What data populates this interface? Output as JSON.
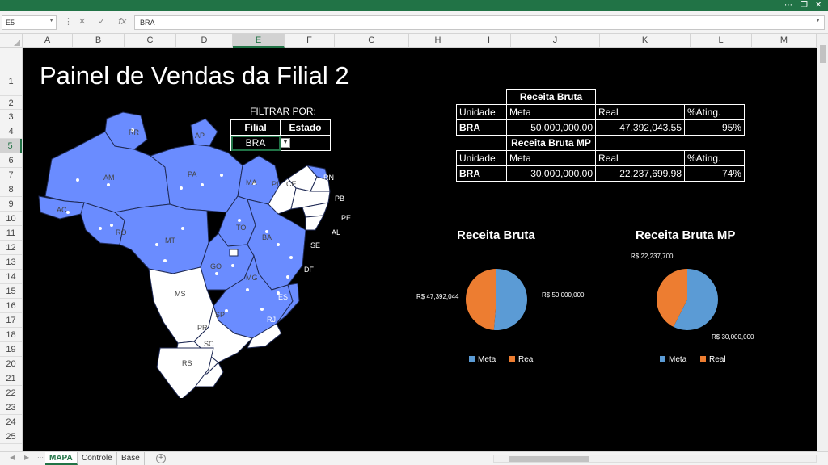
{
  "formula": {
    "cell_ref": "E5",
    "content": "BRA"
  },
  "columns": [
    "A",
    "B",
    "C",
    "D",
    "E",
    "F",
    "G",
    "H",
    "I",
    "J",
    "K",
    "L",
    "M"
  ],
  "rows": [
    "1",
    "2",
    "3",
    "4",
    "5",
    "6",
    "7",
    "8",
    "9",
    "10",
    "11",
    "12",
    "13",
    "14",
    "15",
    "16",
    "17",
    "18",
    "19",
    "20",
    "21",
    "22",
    "23",
    "24",
    "25"
  ],
  "selected_column": "E",
  "selected_row": "5",
  "dashboard": {
    "title": "Painel de Vendas da Filial 2",
    "filter_label": "FILTRAR POR:",
    "filter_headers": [
      "Filial",
      "Estado"
    ],
    "filter_value": "BRA"
  },
  "kpi_bruta": {
    "title": "Receita Bruta",
    "headers": [
      "Unidade",
      "Meta",
      "Real",
      "%Ating."
    ],
    "row": [
      "BRA",
      "50,000,000.00",
      "47,392,043.55",
      "95%"
    ]
  },
  "kpi_mp": {
    "title": "Receita Bruta MP",
    "headers": [
      "Unidade",
      "Meta",
      "Real",
      "%Ating."
    ],
    "row": [
      "BRA",
      "30,000,000.00",
      "22,237,699.98",
      "74%"
    ]
  },
  "map": {
    "states_highlighted": [
      "RR",
      "AP",
      "AM",
      "PA",
      "MA",
      "AC",
      "RO",
      "TO",
      "MT",
      "BA",
      "GO",
      "MG",
      "ES"
    ],
    "states_other": [
      "PI",
      "CE",
      "RN",
      "PB",
      "PE",
      "AL",
      "SE",
      "DF",
      "MS",
      "SP",
      "RJ",
      "PR",
      "SC",
      "RS"
    ],
    "colors": {
      "highlight": "#6a8cff",
      "other": "#ffffff",
      "border": "#1f2a55"
    }
  },
  "chart_data": [
    {
      "type": "pie",
      "title": "Receita Bruta",
      "categories": [
        "Meta",
        "Real"
      ],
      "values": [
        50000000,
        47392044
      ],
      "labels": [
        "R$ 50,000,000",
        "R$ 47,392,044"
      ],
      "colors": [
        "#5b9bd5",
        "#ed7d31"
      ],
      "legend": "bottom"
    },
    {
      "type": "pie",
      "title": "Receita Bruta MP",
      "categories": [
        "Meta",
        "Real"
      ],
      "values": [
        30000000,
        22237700
      ],
      "labels": [
        "R$ 30,000,000",
        "R$ 22,237,700"
      ],
      "colors": [
        "#5b9bd5",
        "#ed7d31"
      ],
      "legend": "bottom"
    }
  ],
  "sheet_tabs": [
    "MAPA",
    "Controle",
    "Base"
  ],
  "active_tab": "MAPA"
}
